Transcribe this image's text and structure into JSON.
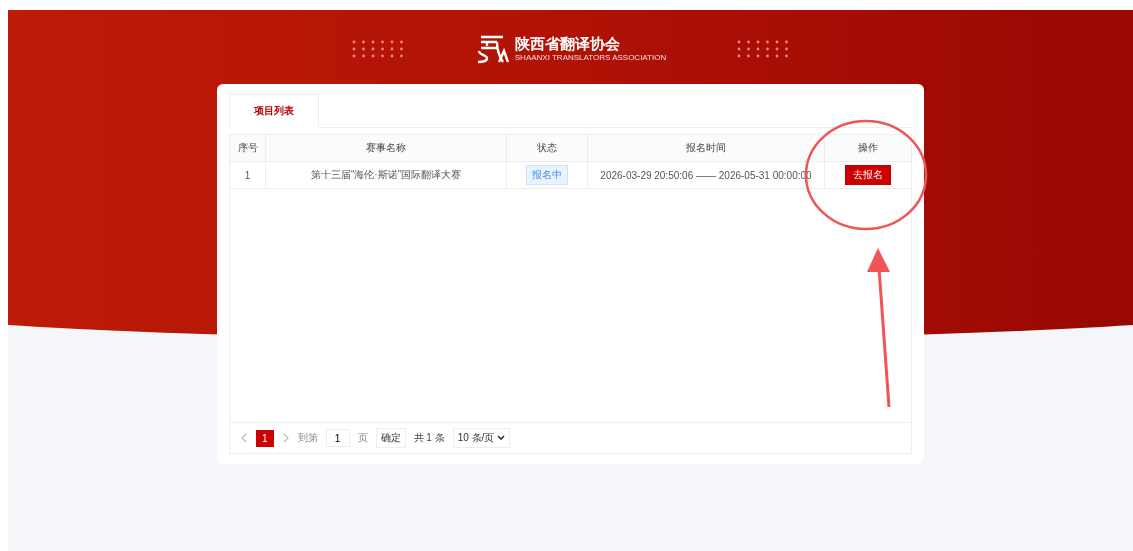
{
  "header": {
    "title": "陕西省翻译协会",
    "subtitle": "SHAANXI TRANSLATORS ASSOCIATION"
  },
  "tabs": [
    {
      "label": "项目列表",
      "selected": true
    }
  ],
  "table": {
    "columns": [
      "序号",
      "赛事名称",
      "状态",
      "报名时间",
      "操作"
    ],
    "rows": [
      {
        "index": "1",
        "name": "第十三届“海伦·斯诺”国际翻译大赛",
        "status": "报名中",
        "time": "2026-03-29 20:50:06 —— 2026-05-31 00:00:00",
        "action": "去报名"
      }
    ]
  },
  "pagination": {
    "pages": [
      {
        "label": "1",
        "selected": true
      }
    ],
    "goto_label": "到第",
    "goto_value": "1",
    "page_unit": "页",
    "confirm": "确定",
    "total": "共 1 条",
    "page_size": "10 条/页"
  }
}
